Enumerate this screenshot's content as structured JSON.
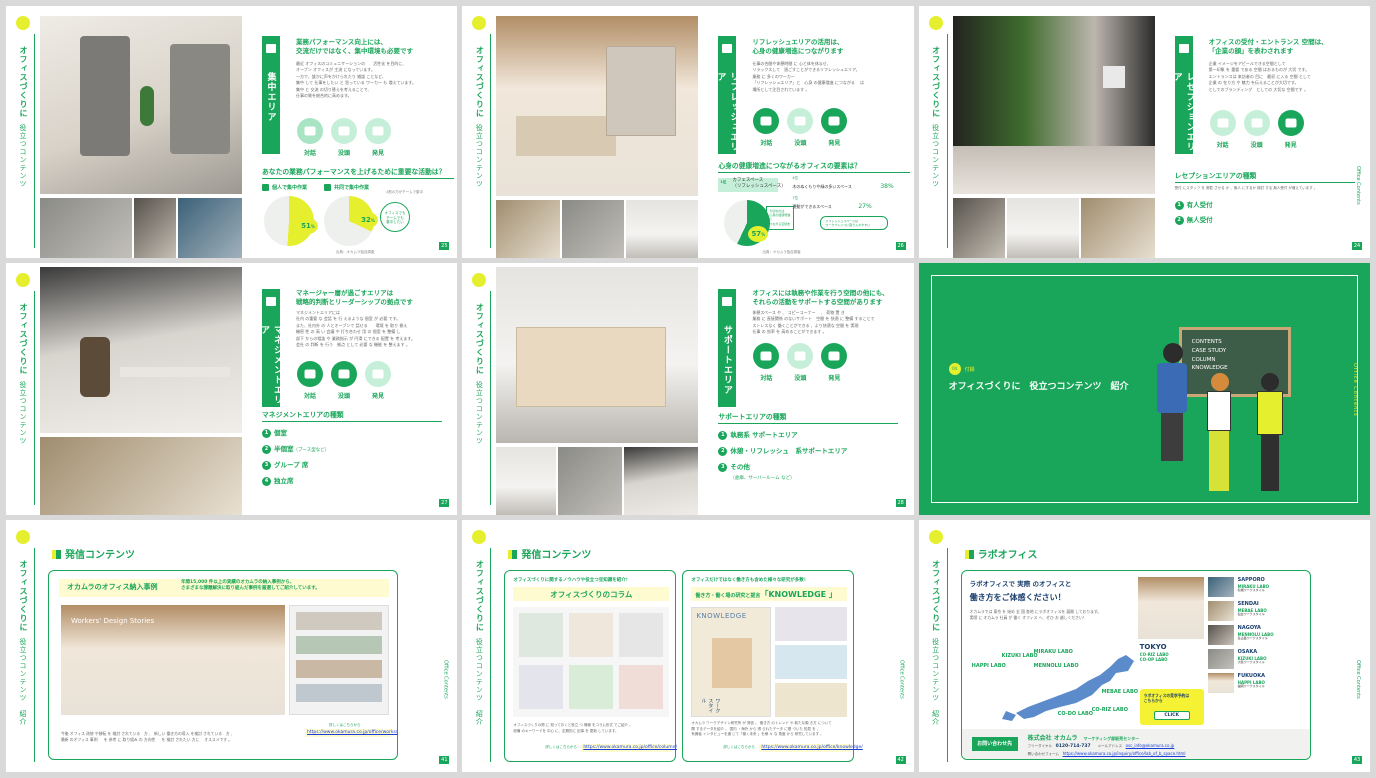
{
  "vt_title": "オフィスづくりに",
  "vt_sub": "役立つコンテンツ",
  "vt_sub_slide7": "役立つコンテンツ　紹介",
  "right_side": "Office Contents",
  "footer": "OFFICE DESIGN ・ SPACE ・ TIPS ・ CONTENTS",
  "slide1": {
    "bar": "集中エリア",
    "heading": "業務パフォーマンス向上には、\n交流だけではなく、集中環境も必要です",
    "body": "最近 オフィスのコミュニケーションの　　活性化 を目的に、\nオープン オフィスが 主流 になっています。\n一方で、誰かに声をかけられたり 雑談 ことなど、\n集中 して 仕事をしたい と 思っている ワーカー も 増えています。\n集中 と 交流 の切り替えを考えることで、\n仕事の質を総合的に高めます。",
    "icons": [
      "対話",
      "没頭",
      "発見"
    ],
    "section": "あなたの業務パフォーマンスを上げるために重要な活動は？",
    "q1": "個人で集中作業",
    "q2": "共同で集中作業",
    "p1": "51",
    "p2": "32",
    "unit": "%",
    "bubble": "オフィスでも\nチームでも\n集中したい",
    "note": "出典：オカムラ独自調査",
    "side_note": "4割の方がチームで集中",
    "page": "25"
  },
  "slide2": {
    "bar": "リフレッシュエリア",
    "heading": "リフレッシュエリアの活用は、\n心身の健康増進につながります",
    "body": "仕事の合間や休憩時間 に 心と体を休ませ、\nリラックスして　過ごすことができるリフレッシュエリア。\n業務 に 多くのワーカー\n「リフレッシュエリア」と　心身 の健康増進 につながる 　は\n場所として注目されています 。",
    "icons": [
      "対話",
      "没頭",
      "発見"
    ],
    "section": "心身の健康増進につながるオフィスの要素は？",
    "r1_rank": "1位",
    "r1": "カフェスペース\n（リフレッシュスペース）",
    "r2_rank": "4位",
    "r2": "木のぬくもりや緑の多いスペース",
    "r2_v": "38",
    "r3_rank": "7位",
    "r3": "運動ができるスペース",
    "r3_v": "27",
    "p1": "57",
    "unit": "%",
    "callout1": "大切なのは\n心身の健康増進に\nつながる空間を",
    "callout2": "リフレッシュスペースは\nワークプレイスに取り入れやすい",
    "note": "出典：オカムラ独自調査",
    "page": "26"
  },
  "slide3": {
    "bar": "レセプションエリア",
    "heading": "オフィスの受付・エントランス 空間は、\n「企業の顔」を表わされます",
    "body": "企業 イメージをアピールできる空間として\n第一印象 を 重要 である 空間 はおるものが 大切 です。\nエントランスは 来訪者の 目に　最初 に入る 空間 として\n企業 の 在り方 や 魅力 を伝えることが大切です。\nとしてのブランディング　としての 大切な 空間です 。",
    "icons": [
      "対話",
      "没頭",
      "発見"
    ],
    "section": "レセプションエリアの種類",
    "section_sub": "受付 にスタッフ を 常駐 させる か 、無人 にするか 検討 する 無人受付 が増えています 。",
    "items": [
      "有人受付",
      "無人受付"
    ],
    "page": "24"
  },
  "slide4": {
    "bar": "マネジメントエリア",
    "heading": "マネージャー層が過ごすエリアは\n戦略的判断とリーダーシップの拠点です",
    "body": "マネジメントエリアには\n社内 の重要 な 会話 を 行 えるような 個室 が 必要 です。\nまた、社内外 の 人とオープンで 話せる　　環境 を 取り 揃え\n機密 性 の 高 い 会議 や 打ち合わせ 用 の 個室 を 整備 し\n部下 からの相談 や 業務指示 が 円滑 にできる 配置 を 考えます。\n会社 の 判断 を 行う　拠点 として 必要 な 機能 を 整えます 。",
    "icons": [
      "対話",
      "没頭",
      "発見"
    ],
    "section": "マネジメントエリアの種類",
    "items": [
      "個室",
      "半個室",
      "グループ 席",
      "独立席"
    ],
    "items_sub": [
      "",
      "（ブース型など）",
      "",
      ""
    ],
    "page": "27"
  },
  "slide5": {
    "bar": "サポートエリア",
    "heading": "オフィスには執務や作業を行う空間の他にも、\nそれらの活動をサポートする空間があります",
    "body": "休憩スペース や 、 コピーコーナー　 、 荷物 置 き\n業務 に 直接関係 のないサポート　空間 を 快適 に 整備 することで\nストレスなく 働くことができる 、より快適な 空間 を 実現\n仕事 の 効率 を 高めることができます 。",
    "icons": [
      "対話",
      "没頭",
      "発見"
    ],
    "section": "サポートエリアの種類",
    "items": [
      "執務系 サポートエリア",
      "休憩・リフレッシュ　系サポートエリア",
      "その他"
    ],
    "items_sub": [
      "",
      "",
      "（倉庫、サーバールーム など）"
    ],
    "page": "28"
  },
  "slide6": {
    "badge_num": "04",
    "badge": "付録",
    "title": "オフィスづくりに　役立つコンテンツ　紹介",
    "board": [
      "CONTENTS",
      "CASE STUDY",
      "COLUMN",
      "KNOWLEDGE"
    ],
    "side": "Office Contents"
  },
  "slide7": {
    "title": "発信コンテンツ",
    "box_title": "オカムラのオフィス納入事例",
    "box_desc": "年間15,000 件以上の実績のオカムラの納入事例から、\nさまざまな課題解決に取り組んだ事例を厳選してご紹介しています。",
    "screen_title": "Workers' Design Stories",
    "body": "今後 オフィス 改修 や移転 を 検討 されている　方 、 新しい 働き方の導入 を検討 されている　方 、\n最新 のオフィス 事例 　 を 参考 に 取り組み の 方向性 　 を 検討 されたい 方に　 オススメです 。",
    "url_label": "詳しくはこちらから",
    "url": "https://www.okamura.co.jp/office/works/",
    "page": "41"
  },
  "slide8": {
    "title": "発信コンテンツ",
    "left_tag": "オフィスづくりに関するノウハウや役立つ豆知識を紹介！",
    "left_title": "オフィスづくりのコラム",
    "left_body": "オフィスづくりの際 に 知っておくと役立 つ 情報 をコラム形式 でご紹介 。\n設備 のキーワードを 中心 に、定期的に 記事 を 更新 しています。",
    "left_url_label": "詳しくはこちらから",
    "left_url": "https://www.okamura.co.jp/office/column/",
    "right_tag": "オフィスだけではなく働き方も含めた様々な研究が多数！",
    "right_title_pre": "働き方・働く場の研究と提言",
    "right_title": "「KNOWLEDGE 」",
    "right_body": "オカムラ ワークデザイン研究所 が 発信 。 働き方 のトレンド や 新たな働 き方 について\n関 するデータを紹介 。 国内 ・海外 から 得 られたデータ に基 づいた 知見 を 、\n有識者 インタビューを通 じて「働く未来 」を様 々 な 角度 から 研究しています 。",
    "right_url_label": "詳しくはこちらから",
    "right_url": "https://www.okamura.co.jp/office/knowledge/",
    "cover1": "KNOWLEDGE",
    "cover2": "ワークスタイル",
    "page": "42"
  },
  "slide9": {
    "title": "ラボオフィス",
    "head1": "ラボオフィスで 実際 のオフィスと",
    "head2": "働き方をご体感ください！",
    "body": "オカムラでは 東京 を 始め 全 国 各地 にラボオフィスを 展開 しております。\n実際 に オカムラ 社員 が 働く オフィス へ、ぜひ お 越しください！",
    "tokyo": "TOKYO",
    "tokyo_labs": [
      "CO-RIZ LABO",
      "CO-OP LABO"
    ],
    "map_labs": [
      "HAPPI LABO",
      "KIZUKI LABO",
      "MIRAKU LABO",
      "MENNOLU LABO",
      "MEBAE LABO",
      "CO-DO LABO",
      "CO-RIZ LABO"
    ],
    "cities": [
      {
        "city": "SAPPORO",
        "lab": "MIRAKU LABO",
        "addr": "札幌ワークスタイル"
      },
      {
        "city": "SENDAI",
        "lab": "MEBAE LABO",
        "addr": "仙台ワークスタイル"
      },
      {
        "city": "NAGOYA",
        "lab": "MENNOLU LABO",
        "addr": "名古屋ワークスタイル"
      },
      {
        "city": "OSAKA",
        "lab": "KIZUKI LABO",
        "addr": "大阪ワークスタイル"
      },
      {
        "city": "FUKUOKA",
        "lab": "HAPPI LABO",
        "addr": "福岡ワークスタイル"
      }
    ],
    "cta": "ラボオフィスの見学予約は\nこちらから",
    "cta_btn": "CLICK",
    "contact_btn": "お問い合わせ先",
    "company": "株式会社 オカムラ",
    "dept": "マーケティング部販売センター",
    "free_label": "フリーダイヤル",
    "free": "0120-714-737",
    "mail_label": "メールアドレス",
    "mail": "osc_info@okamura.co.jp",
    "form_label": "問い合わせフォーム",
    "form": "https://www.okamura.co.jp/inquiry/office/lab_of_b_space.html",
    "page": "43"
  },
  "colors": {
    "green": "#1aa65a",
    "yellow": "#e6ef2d",
    "light_green": "#a9e5c4"
  }
}
